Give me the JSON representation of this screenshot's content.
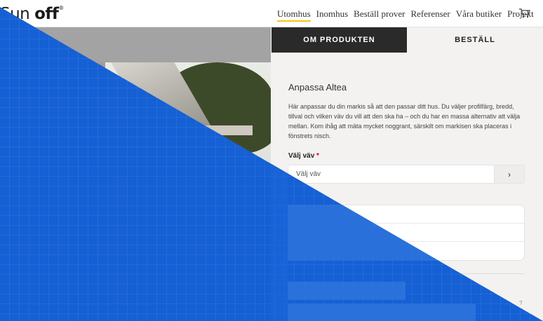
{
  "brand": {
    "logo_sun": "Sun ",
    "logo_off": "off",
    "logo_reg": "®"
  },
  "nav": {
    "items": [
      {
        "label": "Utomhus",
        "active": true
      },
      {
        "label": "Inomhus",
        "active": false
      },
      {
        "label": "Beställ prover",
        "active": false
      },
      {
        "label": "Referenser",
        "active": false
      },
      {
        "label": "Våra butiker",
        "active": false
      },
      {
        "label": "Projekt",
        "active": false
      }
    ],
    "cart_icon": "cart-icon"
  },
  "tabs": [
    {
      "label": "OM PRODUKTEN",
      "active": true
    },
    {
      "label": "BESTÄLL",
      "active": false
    }
  ],
  "product": {
    "title": "Anpassa Altea",
    "description": "Här anpassar du din markis så att den passar ditt hus. Du väljer profilfärg, bredd, tillval och vilken väv du vill att den ska ha – och du har en massa alternativ att välja mellan. Kom ihåg att mäta mycket noggrant, särskilt om markisen ska placeras i fönstrets nisch."
  },
  "fabric_field": {
    "label": "Välj väv",
    "required_mark": "*",
    "value": "Välj väv",
    "button_icon": "chevron-right-icon",
    "button_glyph": "›"
  },
  "footer": {
    "help": "?"
  },
  "colors": {
    "accent": "#f3c613",
    "overlay_blue": "#1560d4",
    "tab_dark": "#2a2a2a",
    "panel_bg": "#f3f2f0"
  }
}
